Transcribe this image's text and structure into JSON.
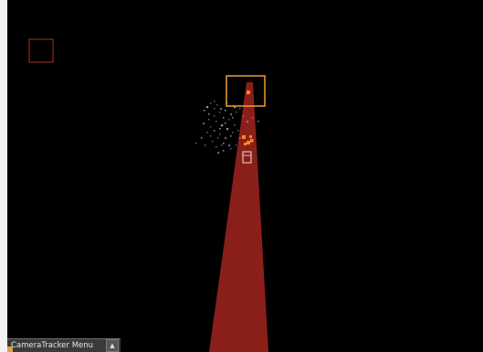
{
  "viewport": {
    "background": "#000000",
    "selection_box_color": "#f0a030",
    "marker_box_color": "#8a2a1e",
    "camera_cone_color": "#8a1f1a",
    "track_point_color": "#ff8a1a",
    "point_cloud_color": "#9aa7b0"
  },
  "menu": {
    "label": "CameraTracker Menu",
    "arrow_icon": "triangle-up-icon",
    "arrow_glyph": "▲"
  }
}
